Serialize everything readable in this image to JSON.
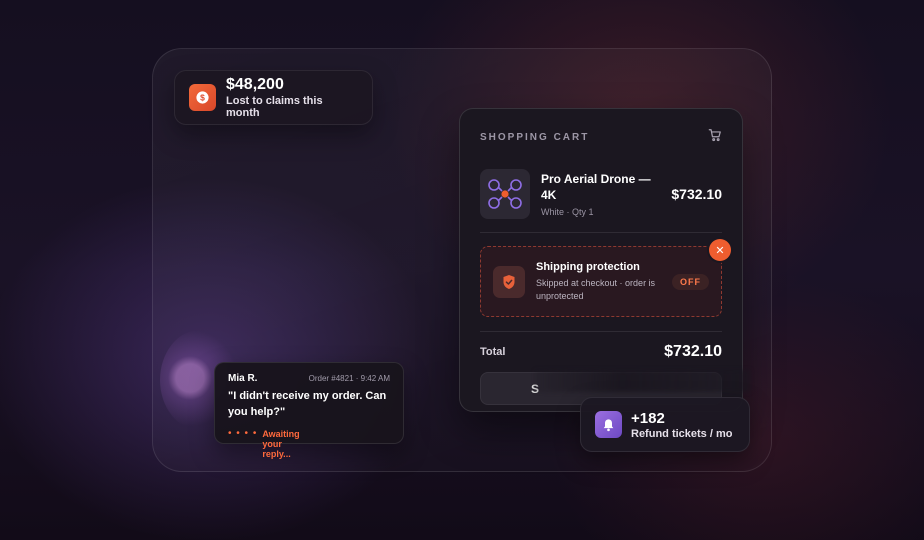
{
  "loss": {
    "amount": "$48,200",
    "label": "Lost to claims this month",
    "icon": "dollar-coin-icon",
    "accent": "#e8522f"
  },
  "cart": {
    "title": "SHOPPING CART",
    "icon": "cart-icon",
    "product": {
      "name": "Pro Aerial Drone — 4K",
      "meta": "White · Qty 1",
      "price": "$732.10",
      "icon": "drone-icon"
    },
    "protection": {
      "title": "Shipping protection",
      "description": "Skipped at checkout · order is unprotected",
      "toggle": "OFF",
      "icon": "shield-icon",
      "close_icon": "close-icon"
    },
    "total_label": "Total",
    "total_value": "$732.10",
    "checkout_label": "S"
  },
  "refund": {
    "count": "+182",
    "label": "Refund tickets / mo",
    "icon": "bell-icon",
    "accent": "#7c55d6"
  },
  "chat": {
    "name": "Mia R.",
    "meta": "Order #4821 · 9:42 AM",
    "message": "\"I didn't receive my order. Can you help?\"",
    "status": "Awaiting your reply...",
    "status_color": "#ff6a3d"
  }
}
